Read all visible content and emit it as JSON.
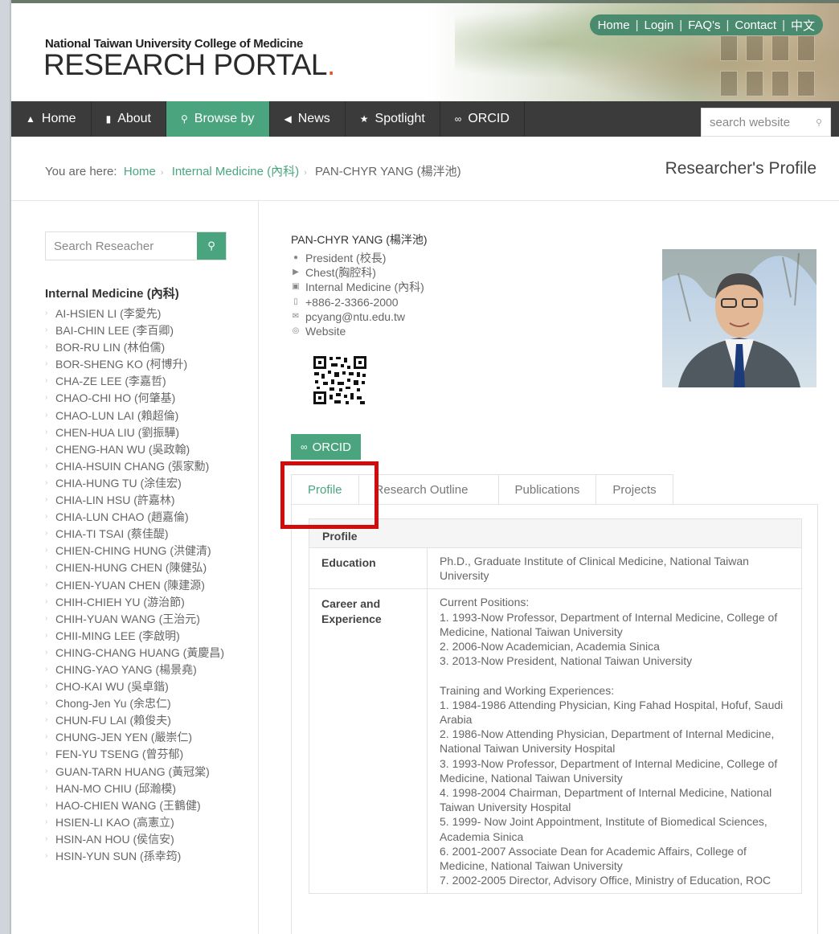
{
  "header": {
    "brand_small": "National Taiwan University College of Medicine",
    "brand_main": "RESEARCH PORTAL",
    "brand_dot": ".",
    "toplinks": [
      "Home",
      "Login",
      "FAQ's",
      "Contact",
      "中文"
    ]
  },
  "nav": {
    "items": [
      {
        "label": "Home",
        "icon": "home-icon"
      },
      {
        "label": "About",
        "icon": "document-icon"
      },
      {
        "label": "Browse by",
        "icon": "search-icon"
      },
      {
        "label": "News",
        "icon": "megaphone-icon"
      },
      {
        "label": "Spotlight",
        "icon": "star-icon"
      },
      {
        "label": "ORCID",
        "icon": "link-icon"
      }
    ],
    "search_placeholder": "search website"
  },
  "breadcrumb": {
    "prefix": "You are here:",
    "home": "Home",
    "section": "Internal Medicine (內科)",
    "current": "PAN-CHYR YANG (楊泮池)",
    "page_heading": "Researcher's Profile"
  },
  "sidebar": {
    "search_placeholder": "Search Reseacher",
    "title": "Internal Medicine (內科)",
    "researchers": [
      "AI-HSIEN LI (李愛先)",
      "BAI-CHIN LEE (李百卿)",
      "BOR-RU LIN (林伯儒)",
      "BOR-SHENG KO (柯博升)",
      "CHA-ZE LEE (李嘉哲)",
      "CHAO-CHI HO (何肇基)",
      "CHAO-LUN LAI (賴超倫)",
      "CHEN-HUA LIU (劉振驊)",
      "CHENG-HAN WU (吳政翰)",
      "CHIA-HSUIN CHANG (張家勳)",
      "CHIA-HUNG TU (涂佳宏)",
      "CHIA-LIN HSU (許嘉林)",
      "CHIA-LUN CHAO (趙嘉倫)",
      "CHIA-TI TSAI (蔡佳醍)",
      "CHIEN-CHING HUNG (洪健清)",
      "CHIEN-HUNG CHEN (陳健弘)",
      "CHIEN-YUAN CHEN (陳建源)",
      "CHIH-CHIEH YU (游治節)",
      "CHIH-YUAN WANG (王治元)",
      "CHII-MING LEE (李啟明)",
      "CHING-CHANG HUANG (黃慶昌)",
      "CHING-YAO YANG (楊景堯)",
      "CHO-KAI WU (吳卓鍇)",
      "Chong-Jen Yu (余忠仁)",
      "CHUN-FU LAI (賴俊夫)",
      "CHUNG-JEN YEN (嚴崇仁)",
      "FEN-YU TSENG (曾芬郁)",
      "GUAN-TARN HUANG (黃冠棠)",
      "HAN-MO CHIU (邱瀚模)",
      "HAO-CHIEN WANG (王鶴健)",
      "HSIEN-LI KAO (高憲立)",
      "HSIN-AN HOU (侯信安)",
      "HSIN-YUN SUN (孫幸筠)"
    ]
  },
  "profile": {
    "name": "PAN-CHYR YANG (楊泮池)",
    "facts": [
      {
        "icon": "person-icon",
        "text": "President (校長)"
      },
      {
        "icon": "tag-icon",
        "text": "Chest(胸腔科)"
      },
      {
        "icon": "building-icon",
        "text": "Internal Medicine (內科)"
      },
      {
        "icon": "phone-icon",
        "text": "+886-2-3366-2000"
      },
      {
        "icon": "envelope-icon",
        "text": "pcyang@ntu.edu.tw"
      },
      {
        "icon": "globe-icon",
        "text": "Website"
      }
    ],
    "orcid_label": "ORCID",
    "tabs": [
      "Profile",
      "Research Outline",
      "Publications",
      "Projects"
    ],
    "table_header": "Profile",
    "education_label": "Education",
    "education_text": "Ph.D., Graduate Institute of Clinical Medicine, National Taiwan University",
    "career_label": "Career and Experience",
    "current_positions_title": "Current Positions:",
    "current_positions": [
      "1. 1993-Now Professor, Department of Internal Medicine, College of Medicine, National Taiwan University",
      "2. 2006-Now Academician, Academia Sinica",
      "3. 2013-Now President, National Taiwan University"
    ],
    "training_title": "Training and Working Experiences:",
    "training": [
      "1. 1984-1986 Attending Physician, King Fahad Hospital, Hofuf, Saudi Arabia",
      "2. 1986-Now Attending Physician, Department of Internal Medicine, National Taiwan University Hospital",
      "3. 1993-Now Professor, Department of Internal Medicine, College of Medicine, National Taiwan University",
      "4. 1998-2004 Chairman, Department of Internal Medicine, National Taiwan University Hospital",
      "5. 1999- Now Joint Appointment, Institute of Biomedical Sciences, Academia Sinica",
      "6. 2001-2007 Associate Dean for Academic Affairs, College of Medicine, National Taiwan University",
      "7. 2002-2005 Director, Advisory Office, Ministry of Education, ROC"
    ]
  },
  "colors": {
    "accent": "#4aa57f",
    "nav_bg": "#3b3b3b",
    "highlight_box": "#d20b0b",
    "brand_dot": "#e8531f"
  }
}
